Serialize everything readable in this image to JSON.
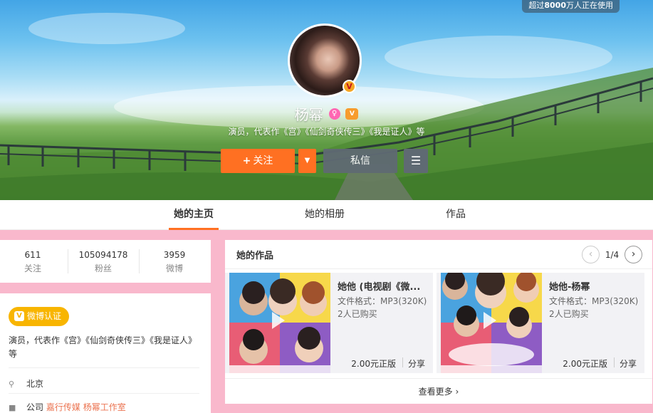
{
  "banner": {
    "users_prefix": "超过",
    "users_count": "8000",
    "users_suffix": "万人正在使用"
  },
  "profile": {
    "name": "杨幂",
    "bio": "演员，代表作《宫》《仙剑奇侠传三》《我是证人》等",
    "verify_badge_icon": "v-badge-icon",
    "gender_icon": "female-icon",
    "vip_icon": "vip-icon",
    "follow_label": "关注",
    "message_label": "私信",
    "accent": "#ff7022"
  },
  "tabs": [
    "她的主页",
    "她的相册",
    "作品"
  ],
  "stats": [
    {
      "value": "611",
      "label": "关注"
    },
    {
      "value": "105094178",
      "label": "粉丝"
    },
    {
      "value": "3959",
      "label": "微博"
    }
  ],
  "info": {
    "verify_label": "微博认证",
    "bio": "演员，代表作《宫》《仙剑奇侠传三》《我是证人》等",
    "location": "北京",
    "company_label": "公司",
    "company_1": "嘉行传媒",
    "company_2": "杨幂工作室"
  },
  "works": {
    "title": "她的作品",
    "page": "1/4",
    "more_label": "查看更多",
    "items": [
      {
        "title": "她他 (电视剧《微...",
        "format": "文件格式：MP3(320K)",
        "buyers": "2人已购买",
        "price": "2.00元正版",
        "share": "分享"
      },
      {
        "title": "她他-杨幂",
        "format": "文件格式：MP3(320K)",
        "buyers": "2人已购买",
        "price": "2.00元正版",
        "share": "分享"
      }
    ]
  }
}
